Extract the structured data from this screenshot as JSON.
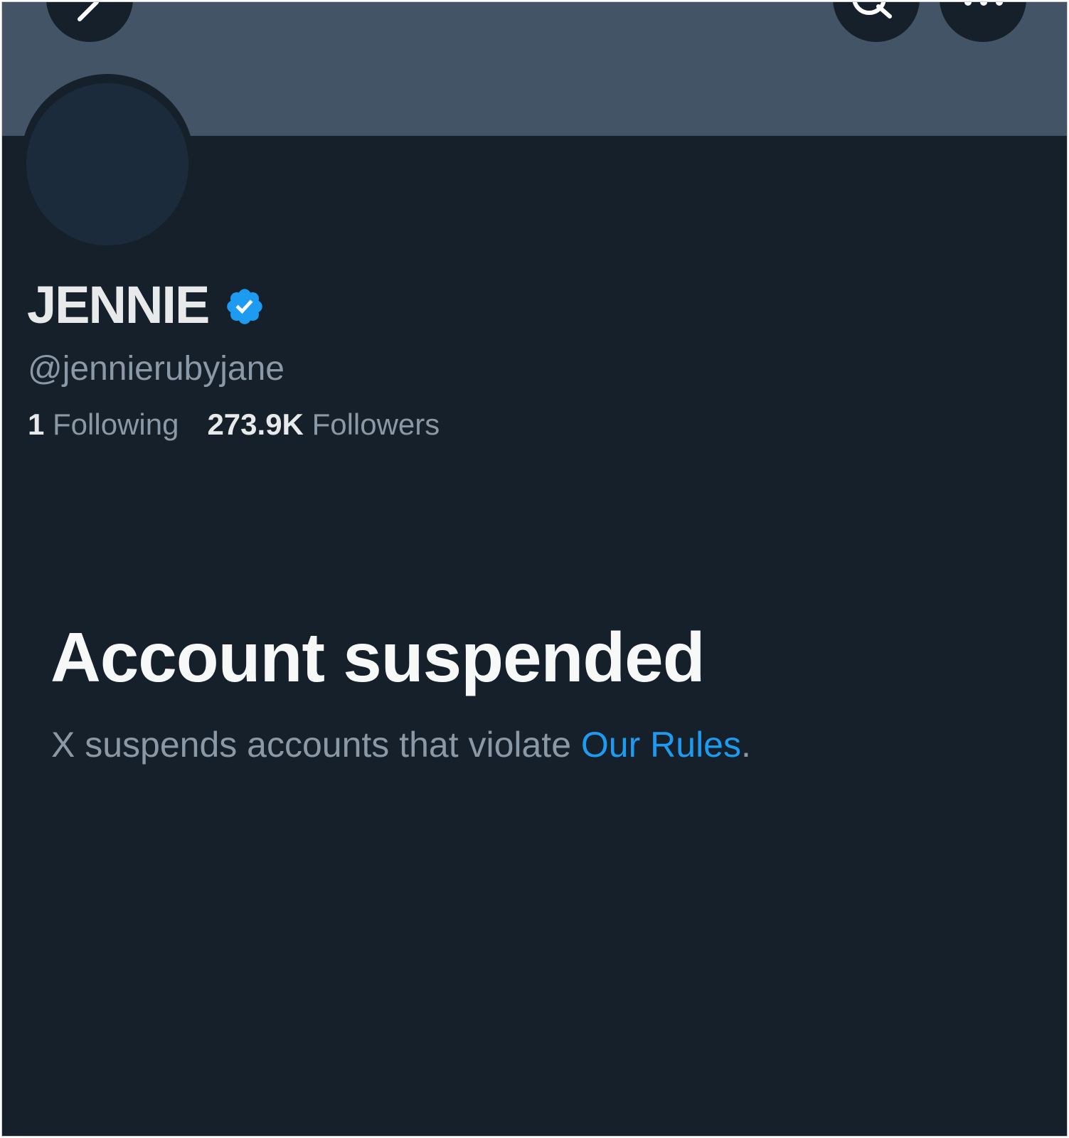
{
  "profile": {
    "display_name": "JENNIE",
    "handle": "@jennierubyjane",
    "verified_badge": "verified-badge-icon",
    "following_count": "1",
    "following_label": "Following",
    "followers_count": "273.9K",
    "followers_label": "Followers"
  },
  "header": {
    "back_icon": "back-arrow-icon",
    "search_icon": "search-icon",
    "more_icon": "more-options-icon"
  },
  "suspension": {
    "title": "Account suspended",
    "message_prefix": "X suspends accounts that violate ",
    "rules_link": "Our Rules",
    "message_suffix": "."
  },
  "colors": {
    "background": "#15202b",
    "banner": "#425466",
    "accent": "#1d9bf0",
    "primary_text": "#e7e9ea",
    "secondary_text": "#8b98a5"
  }
}
